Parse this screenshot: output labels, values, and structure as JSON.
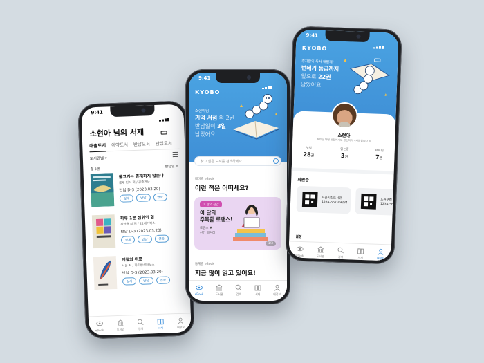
{
  "phone1": {
    "time": "9:41",
    "title": "소현아 님의 서재",
    "tabs": [
      "대출도서",
      "예약도서",
      "반납도서",
      "관심도서"
    ],
    "filter": "도서관별 ▾",
    "count": "총 3권",
    "sort": "반납일 ⇅",
    "books": [
      {
        "title": "물고기는 존재하지 않는다",
        "author": "룰루 밀러 저 / 곰출판사",
        "due": "반납 D-3 (2023.03.20)"
      },
      {
        "title": "하루 1분 섬휘의 힘",
        "author": "김한용 외 저 / 21세기북스",
        "due": "반납 D-3 (2023.03.20)"
      },
      {
        "title": "계절의 위로",
        "author": "서은 저 / 자기반성하우스",
        "due": "반납 D-3 (2023.03.20)"
      }
    ],
    "book_buttons": [
      "상세",
      "반납",
      "연장"
    ],
    "tabbar": [
      "eBook",
      "도서관",
      "검색",
      "서재",
      "내정보"
    ]
  },
  "phone2": {
    "time": "9:41",
    "logo": "KYOBO",
    "hero_small": "소현아님",
    "hero_line1a": "기억 서점",
    "hero_line1b": " 외 2권",
    "hero_line2a": "반납일이 ",
    "hero_line2b": "3일",
    "hero_line3": "남았어요",
    "search_placeholder": "찾고 싶은 도서를 검색하세요",
    "section1_label": "테마별 eBook",
    "section1_title": "이런 책은 어떠세요?",
    "promo_tag": "이 달의 신간",
    "promo_title_1": "이 달의",
    "promo_title_2": "주목할 로맨스!",
    "promo_sub_1": "로맨스 ♥",
    "promo_sub_2": "신간 챙겨라",
    "promo_page": "1/3",
    "section2_label": "통계별 eBook",
    "section2_title": "지금 많이 읽고 있어요!",
    "tabbar": [
      "eBook",
      "도서관",
      "검색",
      "서재",
      "내정보"
    ]
  },
  "phone3": {
    "time": "9:41",
    "logo": "KYOBO",
    "hero_small": "경자람의 독서 애벌레!",
    "hero_line1": "번데기 등급까지",
    "hero_line2a": "앞으로 ",
    "hero_line2b": "22권",
    "hero_line3": "남았어요",
    "user_name": "소현아",
    "user_bio": "재밌는 어떤 상황에서도 정신차리 - 사랑합니다 ◎",
    "stats": [
      {
        "label": "누적",
        "value": "28",
        "unit": "권"
      },
      {
        "label": "읽는중",
        "value": "3",
        "unit": "권"
      },
      {
        "label": "완료된",
        "value": "7",
        "unit": "권"
      }
    ],
    "membership_title": "회원증",
    "cards": [
      {
        "name": "서울시립도서관",
        "number": "1234-567-89234"
      },
      {
        "name": "노원구립",
        "number": "1234-567-"
      }
    ],
    "more_label": "설정",
    "tabbar": [
      "eBook",
      "도서관",
      "검색",
      "서재",
      "내정보"
    ]
  },
  "colors": {
    "accent": "#3f8fd6",
    "promo_bg": "#ead6f2",
    "tag": "#d04fb0",
    "background": "#d4dce2"
  }
}
